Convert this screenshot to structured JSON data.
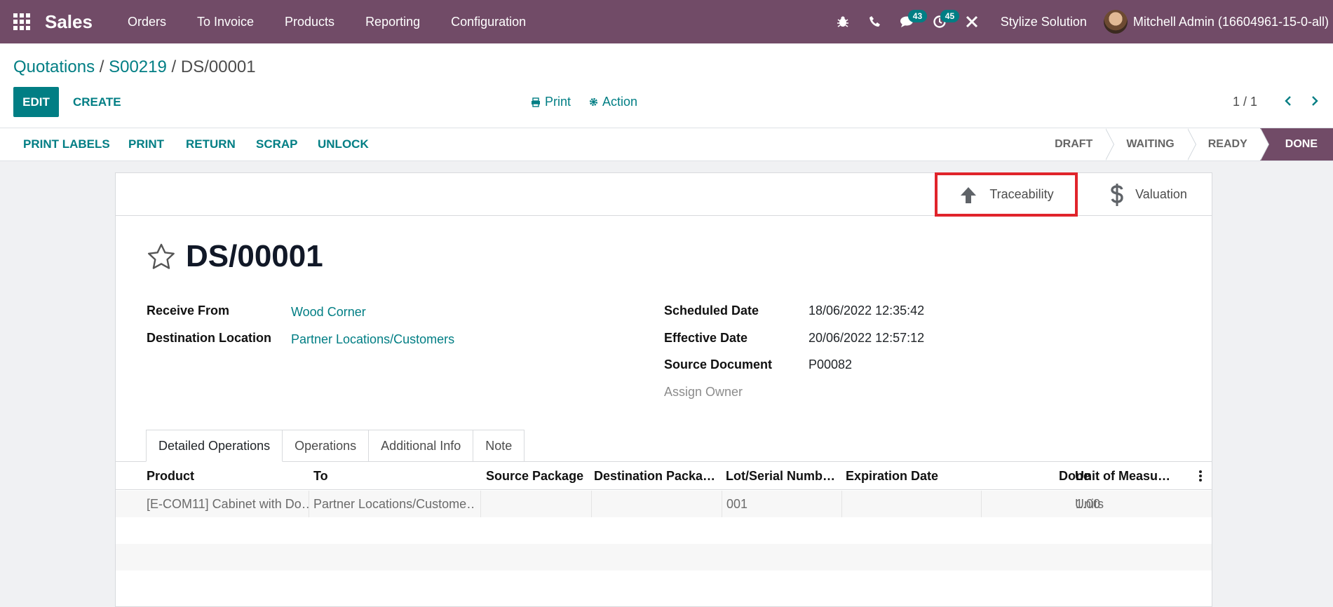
{
  "navbar": {
    "app_name": "Sales",
    "menu": [
      "Orders",
      "To Invoice",
      "Products",
      "Reporting",
      "Configuration"
    ],
    "messages_count": "43",
    "activities_count": "45",
    "company": "Stylize Solution",
    "user": "Mitchell Admin (16604961-15-0-all)"
  },
  "breadcrumb": {
    "level1": "Quotations",
    "sep": " / ",
    "level2": "S00219",
    "current": "DS/00001"
  },
  "control": {
    "edit": "EDIT",
    "create": "CREATE",
    "print": "Print",
    "action": "Action",
    "pager": "1 / 1"
  },
  "statusbar": {
    "buttons": [
      "PRINT LABELS",
      "PRINT",
      "RETURN",
      "SCRAP",
      "UNLOCK"
    ],
    "stages": [
      "DRAFT",
      "WAITING",
      "READY",
      "DONE"
    ],
    "active_stage": "DONE"
  },
  "smart_buttons": {
    "traceability": "Traceability",
    "valuation": "Valuation"
  },
  "record": {
    "name": "DS/00001",
    "receive_from_label": "Receive From",
    "receive_from": "Wood Corner",
    "destination_label": "Destination Location",
    "destination": "Partner Locations/Customers",
    "scheduled_label": "Scheduled Date",
    "scheduled": "18/06/2022 12:35:42",
    "effective_label": "Effective Date",
    "effective": "20/06/2022 12:57:12",
    "source_doc_label": "Source Document",
    "source_doc": "P00082",
    "assign_owner_label": "Assign Owner"
  },
  "tabs": [
    "Detailed Operations",
    "Operations",
    "Additional Info",
    "Note"
  ],
  "table": {
    "headers": [
      "Product",
      "To",
      "Source Package",
      "Destination Packa…",
      "Lot/Serial Numb…",
      "Expiration Date",
      "Done",
      "Unit of Measu…"
    ],
    "rows": [
      [
        "[E-COM11] Cabinet with Do…",
        "Partner Locations/Custome…",
        "",
        "",
        "001",
        "",
        "1.00",
        "Units"
      ]
    ]
  },
  "colors": {
    "brand": "#714b67",
    "accent": "#017e84",
    "highlight": "#e0242b"
  }
}
